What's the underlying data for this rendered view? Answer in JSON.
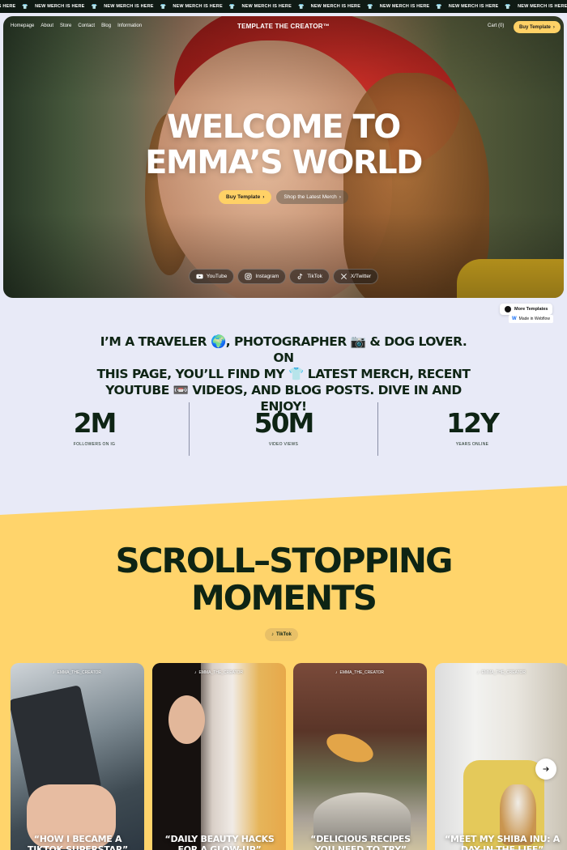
{
  "ticker": {
    "items": [
      "IS HERE",
      "NEW MERCH IS HERE",
      "NEW MERCH IS HERE",
      "NEW MERCH IS HERE",
      "NEW MERCH IS HERE",
      "NEW MERCH IS HERE",
      "NEW MERCH IS HERE",
      "NEW MERCH IS HERE",
      "NEW MERCH IS HERE",
      "NEW MERCH IS HERE"
    ],
    "icon": "tshirt-icon"
  },
  "nav": {
    "links": [
      "Homepage",
      "About",
      "Store",
      "Contact",
      "Blog",
      "Information"
    ],
    "logo": "TEMPLATE THE CREATOR™",
    "cart": "Cart (0)",
    "buy_button": "Buy Template"
  },
  "hero": {
    "title_line1": "WELCOME TO",
    "title_line2": "EMMA’S WORLD",
    "primary_button": "Buy Template",
    "secondary_button": "Shop the Latest Merch",
    "socials": [
      {
        "label": "YouTube",
        "icon": "youtube-icon"
      },
      {
        "label": "Instagram",
        "icon": "instagram-icon"
      },
      {
        "label": "TikTok",
        "icon": "tiktok-icon"
      },
      {
        "label": "X/Twitter",
        "icon": "x-twitter-icon"
      }
    ]
  },
  "badges": {
    "more_templates": "More Templates",
    "made_in_webflow": "Made in Webflow"
  },
  "intro": {
    "line1": "I’M A TRAVELER 🌍, PHOTOGRAPHER 📷 & DOG LOVER.  ON",
    "line2": "THIS PAGE, YOU’LL FIND MY 👕 LATEST MERCH, RECENT",
    "line3": "YOUTUBE 📼 VIDEOS, AND BLOG POSTS. DIVE IN AND ENJOY!"
  },
  "stats": [
    {
      "value": "2M",
      "label": "FOLLOWERS ON IG"
    },
    {
      "value": "50M",
      "label": "VIDEO VIEWS"
    },
    {
      "value": "12Y",
      "label": "YEARS ONLINE"
    }
  ],
  "moments": {
    "title_line1": "SCROLL–STOPPING",
    "title_line2": "MOMENTS",
    "pill": "TikTok",
    "cards": [
      {
        "handle": "EMMA_THE_CREATOR",
        "caption": "“HOW I BECAME A TIKTOK SUPERSTAR”"
      },
      {
        "handle": "EMMA_THE_CREATOR",
        "caption": "“DAILY BEAUTY HACKS FOR A GLOW-UP”"
      },
      {
        "handle": "EMMA_THE_CREATOR",
        "caption": "“DELICIOUS RECIPES YOU NEED TO TRY”"
      },
      {
        "handle": "EMMA_THE_CREATOR",
        "caption": "“MEET MY SHIBA INU: A DAY IN THE LIFE”"
      }
    ],
    "next_icon": "arrow-right-icon"
  },
  "colors": {
    "accent_yellow": "#ffd166",
    "section_yellow": "#ffd46b",
    "dark_green": "#0e2414",
    "page_bg": "#e8eaf7"
  }
}
